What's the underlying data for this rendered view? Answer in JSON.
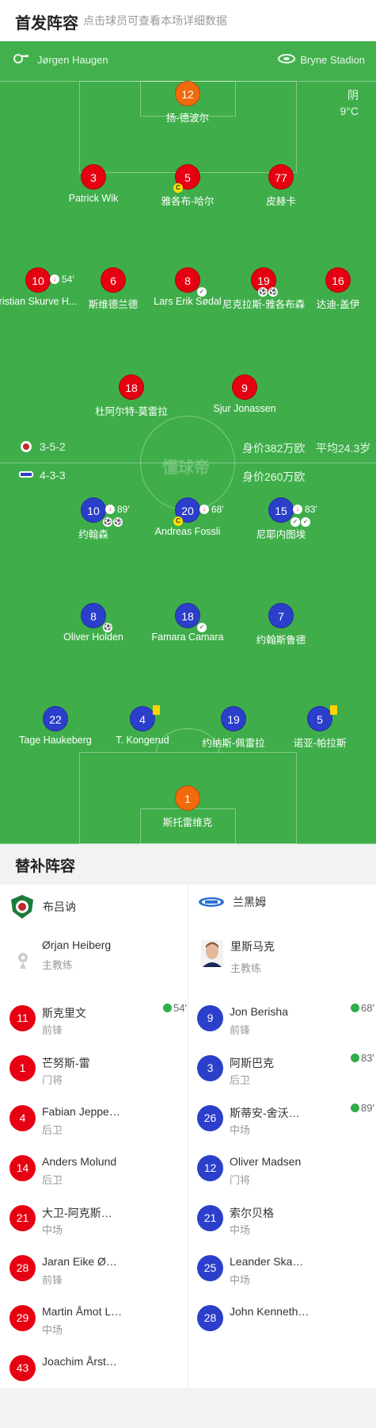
{
  "header": {
    "title": "首发阵容",
    "subtitle": "点击球员可查看本场详细数据"
  },
  "pitch": {
    "referee": "Jørgen Haugen",
    "stadium": "Bryne Stadion",
    "weather": "阴",
    "temperature": "9°C",
    "watermark": "懂球帝",
    "home_formation": "3-5-2",
    "home_value": "身价382万欧",
    "home_avg_age": "平均24.3岁",
    "away_formation": "4-3-3",
    "away_value": "身价260万欧"
  },
  "home_players": [
    {
      "num": "12",
      "name": "扬-德波尔"
    },
    {
      "num": "3",
      "name": "Patrick Wik"
    },
    {
      "num": "5",
      "name": "雅各布-哈尔",
      "captain": "C"
    },
    {
      "num": "77",
      "name": "皮赫卡"
    },
    {
      "num": "10",
      "name": "ristian Skurve H...",
      "sub_time": "54'"
    },
    {
      "num": "6",
      "name": "斯维德兰德"
    },
    {
      "num": "8",
      "name": "Lars Erik Sødal"
    },
    {
      "num": "19",
      "name": "尼克拉斯-雅各布森"
    },
    {
      "num": "16",
      "name": "达迪-盖伊"
    },
    {
      "num": "18",
      "name": "杜阿尔特-莫雷拉"
    },
    {
      "num": "9",
      "name": "Sjur Jonassen"
    }
  ],
  "away_players": [
    {
      "num": "10",
      "name": "约翰森",
      "sub_time": "89'"
    },
    {
      "num": "20",
      "name": "Andreas Fossli",
      "sub_time": "68'",
      "captain": "C"
    },
    {
      "num": "15",
      "name": "尼耶内图埃",
      "sub_time": "83'"
    },
    {
      "num": "8",
      "name": "Oliver Holden"
    },
    {
      "num": "18",
      "name": "Famara Camara"
    },
    {
      "num": "7",
      "name": "约翰斯鲁德"
    },
    {
      "num": "22",
      "name": "Tage Haukeberg"
    },
    {
      "num": "4",
      "name": "T. Kongerud"
    },
    {
      "num": "19",
      "name": "约纳斯-佩雷拉"
    },
    {
      "num": "5",
      "name": "诺亚-帕拉斯"
    },
    {
      "num": "1",
      "name": "斯托雷维克"
    }
  ],
  "subs": {
    "title": "替补阵容",
    "home": {
      "team": "布吕讷",
      "coach": "Ørjan Heiberg",
      "coach_role": "主教练",
      "players": [
        {
          "num": "11",
          "name": "斯克里文",
          "pos": "前锋",
          "time": "54'"
        },
        {
          "num": "1",
          "name": "芒努斯-雷",
          "pos": "门将"
        },
        {
          "num": "4",
          "name": "Fabian Jeppe…",
          "pos": "后卫"
        },
        {
          "num": "14",
          "name": "Anders Molund",
          "pos": "后卫"
        },
        {
          "num": "21",
          "name": "大卫-阿克斯…",
          "pos": "中场"
        },
        {
          "num": "28",
          "name": "Jaran Eike Ø…",
          "pos": "前锋"
        },
        {
          "num": "29",
          "name": "Martin Åmot L…",
          "pos": "中场"
        },
        {
          "num": "43",
          "name": "Joachim Årst…",
          "pos": ""
        }
      ]
    },
    "away": {
      "team": "兰黑姆",
      "coach": "里斯马克",
      "coach_role": "主教练",
      "players": [
        {
          "num": "9",
          "name": "Jon Berisha",
          "pos": "前锋",
          "time": "68'"
        },
        {
          "num": "3",
          "name": "阿斯巴克",
          "pos": "后卫",
          "time": "83'"
        },
        {
          "num": "26",
          "name": "斯蒂安-舍沃…",
          "pos": "中场",
          "time": "89'"
        },
        {
          "num": "12",
          "name": "Oliver Madsen",
          "pos": "门将"
        },
        {
          "num": "21",
          "name": "索尔贝格",
          "pos": "中场"
        },
        {
          "num": "25",
          "name": "Leander Ska…",
          "pos": "中场"
        },
        {
          "num": "28",
          "name": "John Kenneth…",
          "pos": ""
        }
      ]
    }
  },
  "colors": {
    "pitch": "#3fae4a",
    "home": "#e60012",
    "away": "#2b3fcb",
    "keeper": "#f26a0c"
  }
}
